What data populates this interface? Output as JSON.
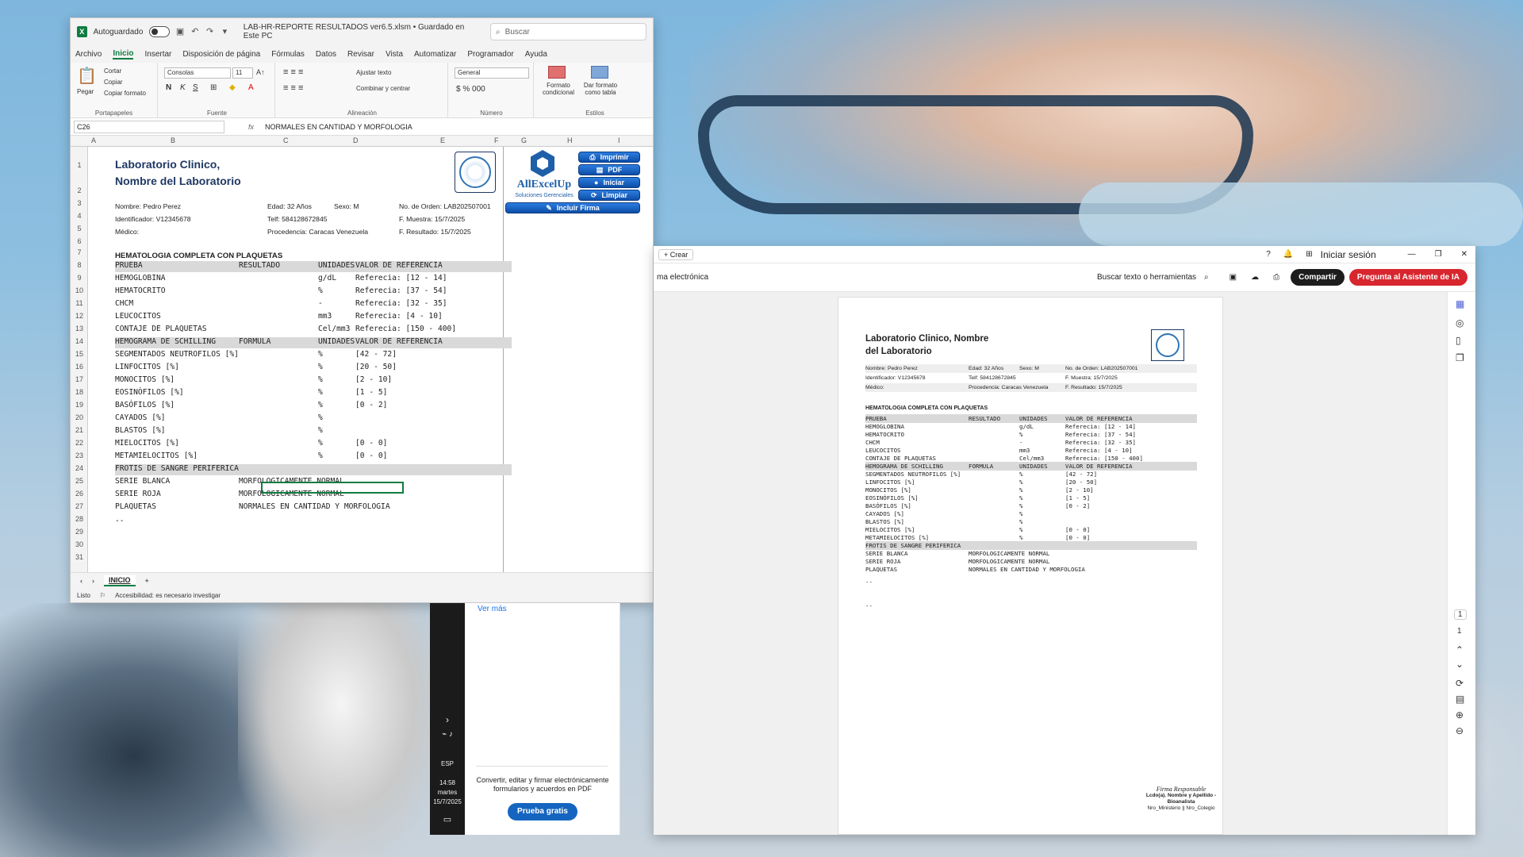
{
  "excel": {
    "autosave_label": "Autoguardado",
    "filename": "LAB-HR-REPORTE RESULTADOS ver6.5.xlsm • Guardado en Este PC",
    "search_placeholder": "Buscar",
    "menu": [
      "Archivo",
      "Inicio",
      "Insertar",
      "Disposición de página",
      "Fórmulas",
      "Datos",
      "Revisar",
      "Vista",
      "Automatizar",
      "Programador",
      "Ayuda"
    ],
    "ribbon": {
      "pegar": "Pegar",
      "cortar": "Cortar",
      "copiar": "Copiar",
      "copiar_formato": "Copiar formato",
      "portapapeles": "Portapapeles",
      "font_name": "Consolas",
      "font_size": "11",
      "fuente": "Fuente",
      "ajustar": "Ajustar texto",
      "combinar": "Combinar y centrar",
      "alineacion": "Alineación",
      "numfmt": "General",
      "numero": "Número",
      "formato_cond": "Formato condicional",
      "dar_formato": "Dar formato como tabla",
      "estilos": "Estilos"
    },
    "name_box": "C26",
    "formula": "NORMALES EN CANTIDAD Y MORFOLOGIA",
    "columns": [
      "A",
      "B",
      "C",
      "D",
      "E",
      "F",
      "G",
      "H",
      "I"
    ],
    "rows": [
      "1",
      "2",
      "3",
      "4",
      "5",
      "6",
      "7",
      "8",
      "9",
      "10",
      "11",
      "12",
      "13",
      "14",
      "15",
      "16",
      "17",
      "18",
      "19",
      "20",
      "21",
      "22",
      "23",
      "24",
      "25",
      "26",
      "27",
      "28",
      "29",
      "30",
      "31"
    ],
    "lab_title": "Laboratorio Clinico,",
    "lab_title2": "Nombre del Laboratorio",
    "patient": {
      "nombre": "Nombre: Pedro Perez",
      "edad": "Edad: 32 Años",
      "sexo": "Sexo: M",
      "orden": "No. de Orden: LAB202507001",
      "id": "Identificador: V12345678",
      "telf": "Telf: 584128672845",
      "muestra": "F. Muestra: 15/7/2025",
      "medico": "Médico:",
      "procedencia": "Procedencia: Caracas Venezuela",
      "resultado": "F. Resultado: 15/7/2025"
    },
    "brand": {
      "name": "AllExcelUp",
      "sub": "Soluciones Gerenciales"
    },
    "macro_buttons": [
      "Imprimir",
      "PDF",
      "Iniciar",
      "Limpiar",
      "Incluir Firma"
    ],
    "sheet_tab": "INICIO",
    "status": "Listo",
    "accessibility": "Accesibilidad: es necesario investigar",
    "dash": "--"
  },
  "report": {
    "section1": "HEMATOLOGIA COMPLETA CON PLAQUETAS",
    "hdr1": [
      "PRUEBA",
      "RESULTADO",
      "UNIDADES",
      "VALOR DE REFERENCIA"
    ],
    "rows1": [
      [
        "HEMOGLOBINA",
        "",
        "g/dL",
        "Referecia: [12 - 14]"
      ],
      [
        "HEMATOCRITO",
        "",
        "%",
        "Referecia: [37 - 54]"
      ],
      [
        "CHCM",
        "",
        "-",
        "Referecia: [32 - 35]"
      ],
      [
        "LEUCOCITOS",
        "",
        "mm3",
        "Referecia: [4 - 10]"
      ],
      [
        "CONTAJE DE PLAQUETAS",
        "",
        "Cel/mm3",
        "Referecia: [150 - 400]"
      ]
    ],
    "hdr2": [
      "HEMOGRAMA DE SCHILLING",
      "FORMULA",
      "UNIDADES",
      "VALOR DE REFERENCIA"
    ],
    "rows2": [
      [
        "SEGMENTADOS NEUTROFILOS [%]",
        "",
        "%",
        "[42 - 72]"
      ],
      [
        "LINFOCITOS [%]",
        "",
        "%",
        "[20 - 50]"
      ],
      [
        "MONOCITOS [%]",
        "",
        "%",
        "[2 - 10]"
      ],
      [
        "EOSINÓFILOS [%]",
        "",
        "%",
        "[1 - 5]"
      ],
      [
        "BASÓFILOS [%]",
        "",
        "%",
        "[0 - 2]"
      ],
      [
        "CAYADOS [%]",
        "",
        "%",
        ""
      ],
      [
        "BLASTOS [%]",
        "",
        "%",
        ""
      ],
      [
        "MIELOCITOS [%]",
        "",
        "%",
        "[0 - 0]"
      ],
      [
        "METAMIELOCITOS [%]",
        "",
        "%",
        "[0 - 0]"
      ]
    ],
    "hdr3": "FROTIS DE SANGRE PERIFERICA",
    "rows3": [
      [
        "SERIE BLANCA",
        "MORFOLOGICAMENTE NORMAL"
      ],
      [
        "SERIE ROJA",
        "MORFOLOGICAMENTE NORMAL"
      ],
      [
        "PLAQUETAS",
        "NORMALES EN CANTIDAD Y MORFOLOGIA"
      ]
    ]
  },
  "pdf": {
    "crear": "+ Crear",
    "signin": "Iniciar sesión",
    "doc_label": "ma electrónica",
    "search": "Buscar texto o herramientas",
    "share": "Compartir",
    "ai": "Pregunta al Asistente de IA",
    "title": "Laboratorio Clinico, Nombre",
    "title2": "del Laboratorio",
    "sign_title": "Firma Responsable",
    "sign_name": "Lcdo(a). Nombre y Apellido - Bioanalista",
    "sign_reg": "Nro_Ministerio || Nro_Colegio",
    "page_num": "1",
    "page_total": "1",
    "dash": "--"
  },
  "promo": {
    "ver_mas": "Ver más",
    "text": "Convertir, editar y firmar electrónicamente formularios y acuerdos en PDF",
    "button": "Prueba gratis"
  },
  "taskbar": {
    "lang": "ESP",
    "time": "14:58",
    "day": "martes",
    "date": "15/7/2025"
  }
}
